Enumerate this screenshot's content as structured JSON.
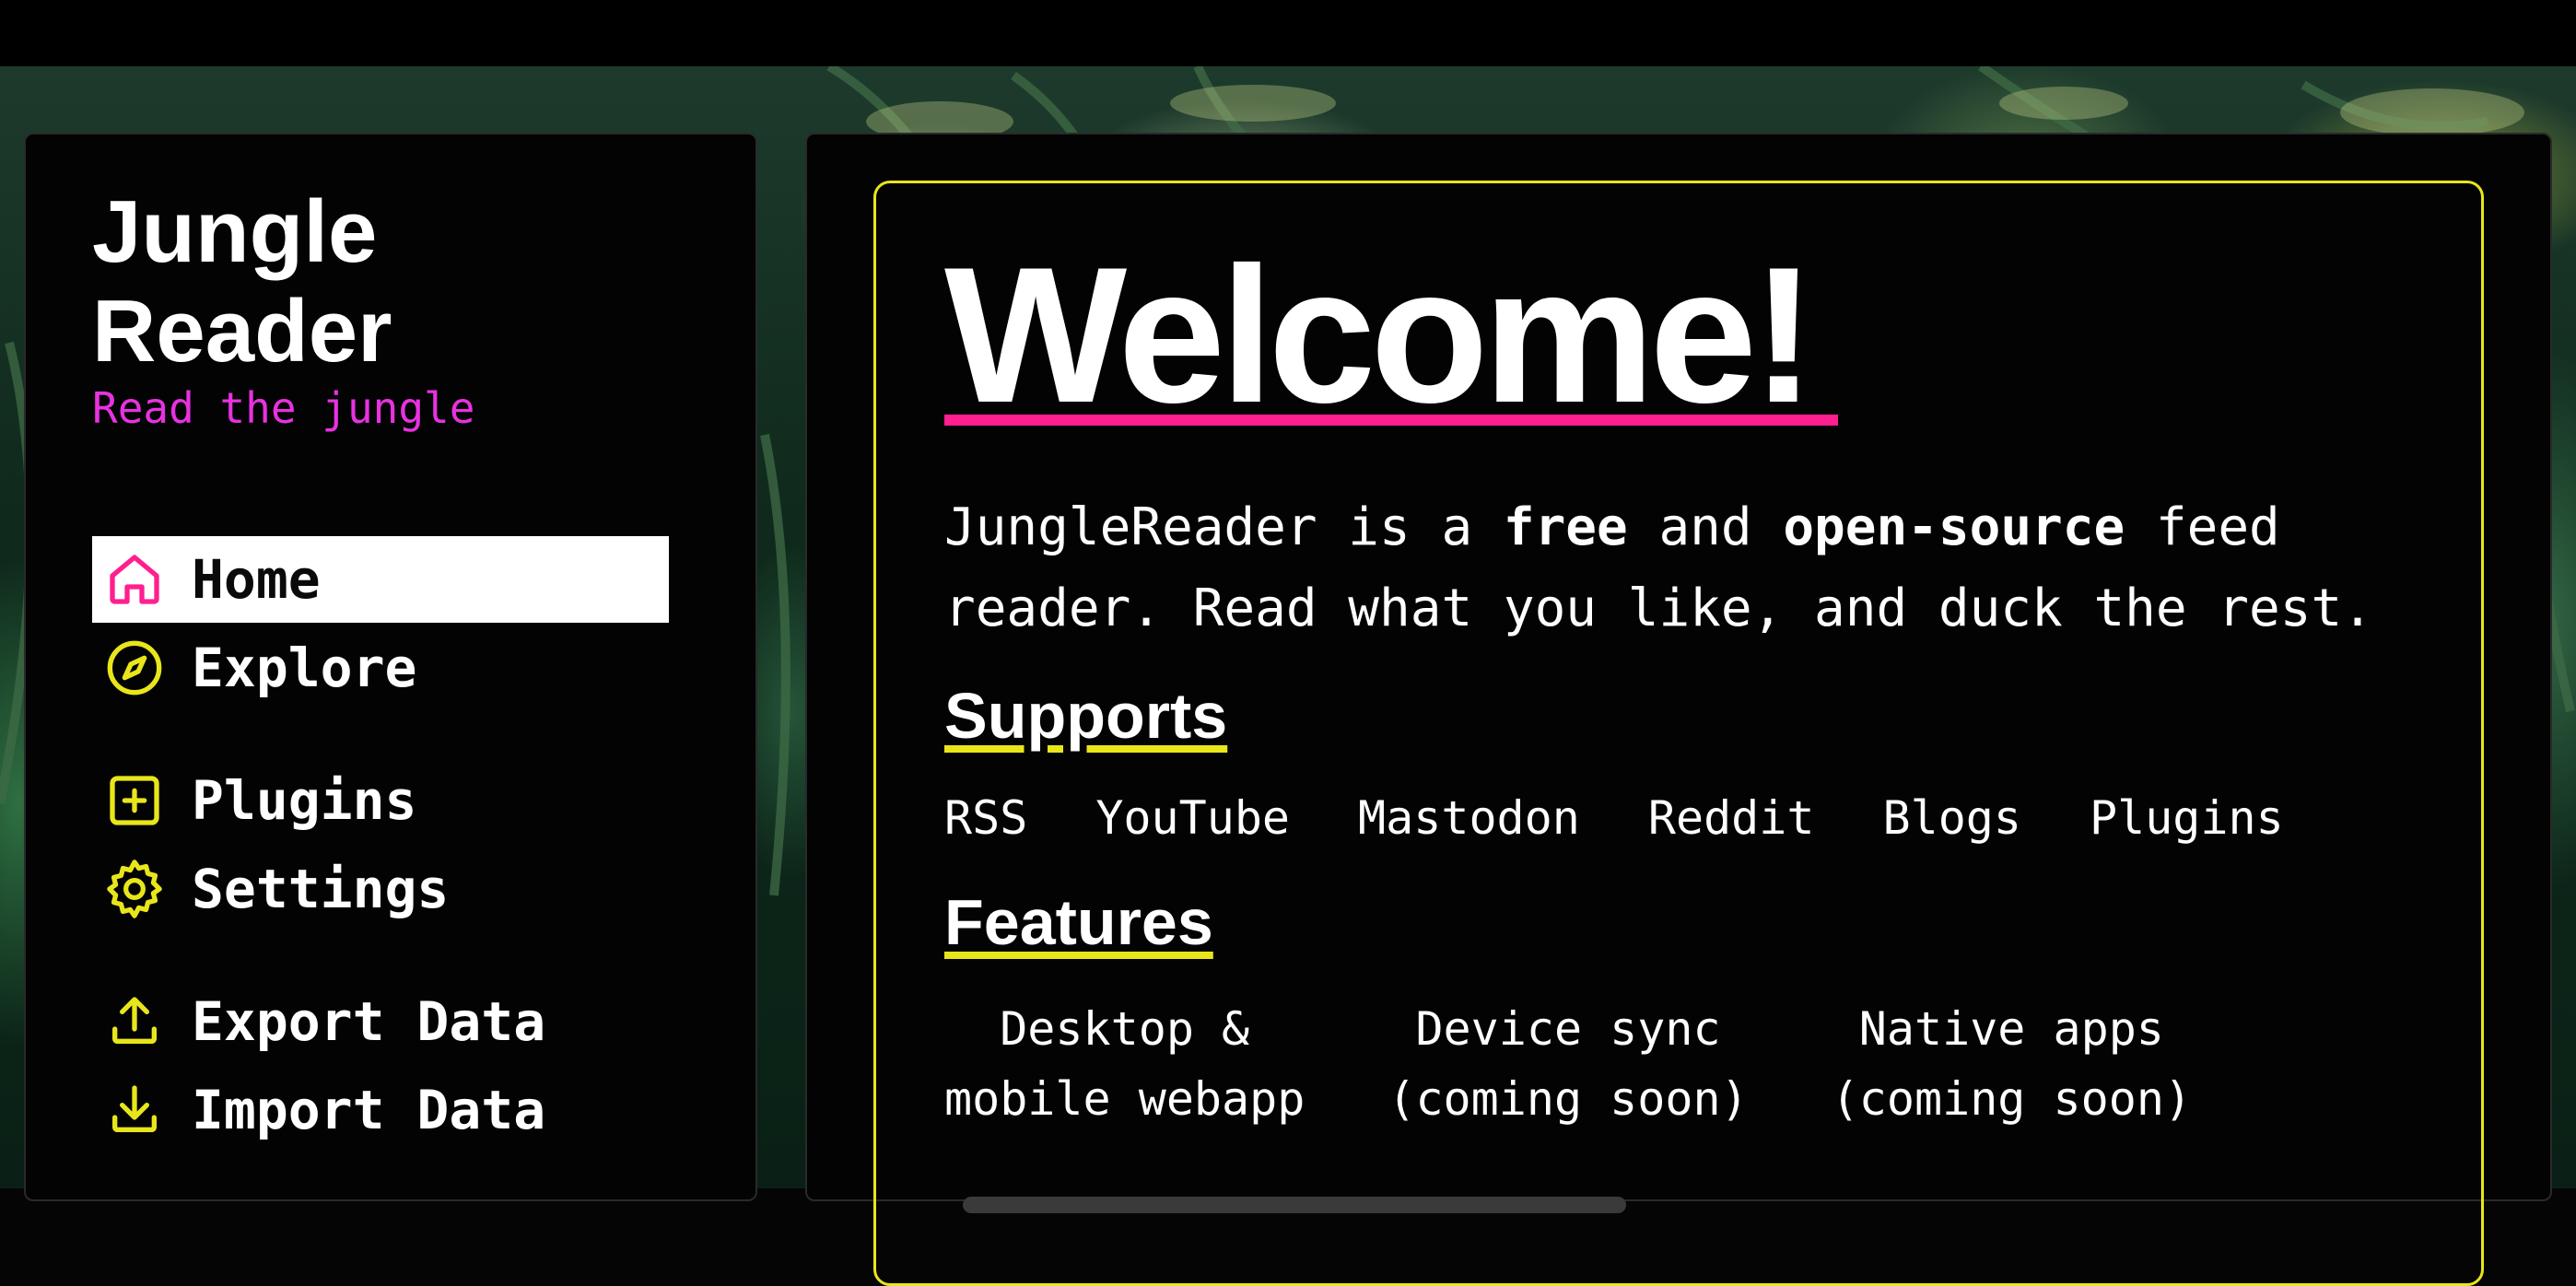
{
  "sidebar": {
    "title_line1": "Jungle",
    "title_line2": "Reader",
    "tagline": "Read the jungle",
    "items": [
      {
        "label": "Home",
        "icon": "home-icon",
        "active": true
      },
      {
        "label": "Explore",
        "icon": "compass-icon"
      },
      {
        "label": "Plugins",
        "icon": "plus-square-icon"
      },
      {
        "label": "Settings",
        "icon": "gear-icon"
      },
      {
        "label": "Export Data",
        "icon": "upload-icon"
      },
      {
        "label": "Import Data",
        "icon": "download-icon"
      }
    ]
  },
  "main": {
    "title": "Welcome!",
    "intro": {
      "p1": "JungleReader is a ",
      "b1": "free",
      "p2": " and ",
      "b2": "open-source",
      "p3": " feed reader. Read what you like, and duck the rest."
    },
    "supports_heading": "Supports",
    "supports": [
      "RSS",
      "YouTube",
      "Mastodon",
      "Reddit",
      "Blogs",
      "Plugins"
    ],
    "features_heading": "Features",
    "features": [
      {
        "line1": "Desktop &",
        "line2": "mobile webapp"
      },
      {
        "line1": "Device sync",
        "line2": "(coming soon)"
      },
      {
        "line1": "Native apps",
        "line2": "(coming soon)"
      }
    ]
  },
  "colors": {
    "accent_magenta": "#e832e0",
    "accent_pink": "#ff1f8e",
    "accent_yellow": "#e8e61a",
    "panel_bg": "#030303"
  }
}
